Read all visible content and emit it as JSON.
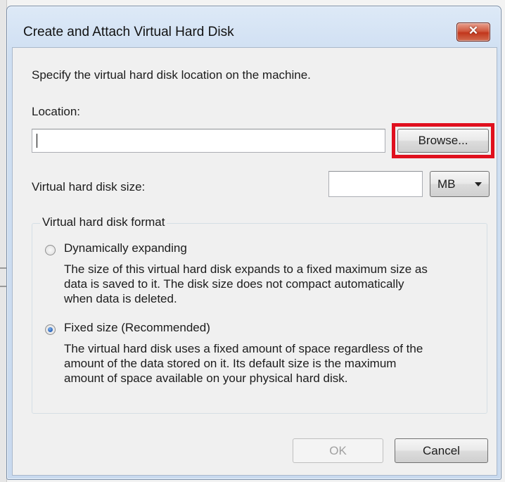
{
  "dialog": {
    "title": "Create and Attach Virtual Hard Disk",
    "close_label": "✕",
    "instruction": "Specify the virtual hard disk location on the machine.",
    "location_label": "Location:",
    "location_value": "",
    "browse_label": "Browse...",
    "size_label": "Virtual hard disk size:",
    "size_value": "",
    "unit_selected": "MB",
    "format_group_label": "Virtual hard disk format",
    "options": [
      {
        "label": "Dynamically expanding",
        "checked": false,
        "description": [
          "The size of this virtual hard disk expands to a fixed maximum size as",
          "data is saved to it.  The disk size does not compact automatically",
          "when data is deleted."
        ]
      },
      {
        "label": "Fixed size (Recommended)",
        "checked": true,
        "description": [
          "The virtual hard disk uses a fixed amount of space regardless of the",
          "amount of the data stored on it.  Its default size is the maximum",
          "amount of space available on your physical hard disk."
        ]
      }
    ],
    "ok_label": "OK",
    "ok_enabled": false,
    "cancel_label": "Cancel"
  },
  "colors": {
    "highlight_border": "#e0101e",
    "close_button": "#c2371c",
    "title_bar": "#cfdff2",
    "radio_selected": "#2a62b8"
  }
}
